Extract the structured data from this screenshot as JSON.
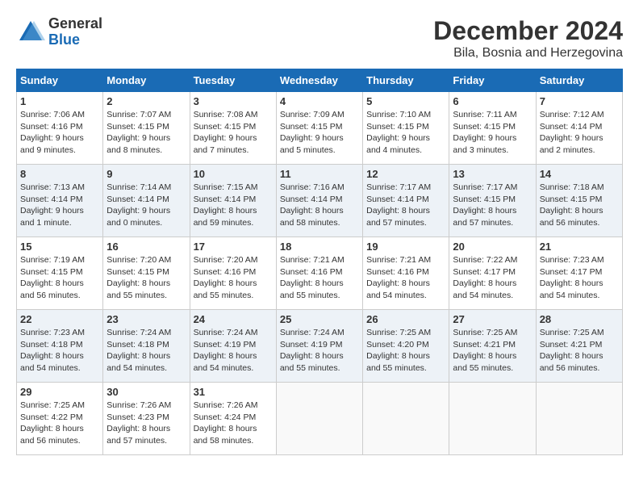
{
  "logo": {
    "general": "General",
    "blue": "Blue"
  },
  "title": "December 2024",
  "subtitle": "Bila, Bosnia and Herzegovina",
  "days_of_week": [
    "Sunday",
    "Monday",
    "Tuesday",
    "Wednesday",
    "Thursday",
    "Friday",
    "Saturday"
  ],
  "weeks": [
    [
      {
        "day": "1",
        "info": "Sunrise: 7:06 AM\nSunset: 4:16 PM\nDaylight: 9 hours and 9 minutes."
      },
      {
        "day": "2",
        "info": "Sunrise: 7:07 AM\nSunset: 4:15 PM\nDaylight: 9 hours and 8 minutes."
      },
      {
        "day": "3",
        "info": "Sunrise: 7:08 AM\nSunset: 4:15 PM\nDaylight: 9 hours and 7 minutes."
      },
      {
        "day": "4",
        "info": "Sunrise: 7:09 AM\nSunset: 4:15 PM\nDaylight: 9 hours and 5 minutes."
      },
      {
        "day": "5",
        "info": "Sunrise: 7:10 AM\nSunset: 4:15 PM\nDaylight: 9 hours and 4 minutes."
      },
      {
        "day": "6",
        "info": "Sunrise: 7:11 AM\nSunset: 4:15 PM\nDaylight: 9 hours and 3 minutes."
      },
      {
        "day": "7",
        "info": "Sunrise: 7:12 AM\nSunset: 4:14 PM\nDaylight: 9 hours and 2 minutes."
      }
    ],
    [
      {
        "day": "8",
        "info": "Sunrise: 7:13 AM\nSunset: 4:14 PM\nDaylight: 9 hours and 1 minute."
      },
      {
        "day": "9",
        "info": "Sunrise: 7:14 AM\nSunset: 4:14 PM\nDaylight: 9 hours and 0 minutes."
      },
      {
        "day": "10",
        "info": "Sunrise: 7:15 AM\nSunset: 4:14 PM\nDaylight: 8 hours and 59 minutes."
      },
      {
        "day": "11",
        "info": "Sunrise: 7:16 AM\nSunset: 4:14 PM\nDaylight: 8 hours and 58 minutes."
      },
      {
        "day": "12",
        "info": "Sunrise: 7:17 AM\nSunset: 4:14 PM\nDaylight: 8 hours and 57 minutes."
      },
      {
        "day": "13",
        "info": "Sunrise: 7:17 AM\nSunset: 4:15 PM\nDaylight: 8 hours and 57 minutes."
      },
      {
        "day": "14",
        "info": "Sunrise: 7:18 AM\nSunset: 4:15 PM\nDaylight: 8 hours and 56 minutes."
      }
    ],
    [
      {
        "day": "15",
        "info": "Sunrise: 7:19 AM\nSunset: 4:15 PM\nDaylight: 8 hours and 56 minutes."
      },
      {
        "day": "16",
        "info": "Sunrise: 7:20 AM\nSunset: 4:15 PM\nDaylight: 8 hours and 55 minutes."
      },
      {
        "day": "17",
        "info": "Sunrise: 7:20 AM\nSunset: 4:16 PM\nDaylight: 8 hours and 55 minutes."
      },
      {
        "day": "18",
        "info": "Sunrise: 7:21 AM\nSunset: 4:16 PM\nDaylight: 8 hours and 55 minutes."
      },
      {
        "day": "19",
        "info": "Sunrise: 7:21 AM\nSunset: 4:16 PM\nDaylight: 8 hours and 54 minutes."
      },
      {
        "day": "20",
        "info": "Sunrise: 7:22 AM\nSunset: 4:17 PM\nDaylight: 8 hours and 54 minutes."
      },
      {
        "day": "21",
        "info": "Sunrise: 7:23 AM\nSunset: 4:17 PM\nDaylight: 8 hours and 54 minutes."
      }
    ],
    [
      {
        "day": "22",
        "info": "Sunrise: 7:23 AM\nSunset: 4:18 PM\nDaylight: 8 hours and 54 minutes."
      },
      {
        "day": "23",
        "info": "Sunrise: 7:24 AM\nSunset: 4:18 PM\nDaylight: 8 hours and 54 minutes."
      },
      {
        "day": "24",
        "info": "Sunrise: 7:24 AM\nSunset: 4:19 PM\nDaylight: 8 hours and 54 minutes."
      },
      {
        "day": "25",
        "info": "Sunrise: 7:24 AM\nSunset: 4:19 PM\nDaylight: 8 hours and 55 minutes."
      },
      {
        "day": "26",
        "info": "Sunrise: 7:25 AM\nSunset: 4:20 PM\nDaylight: 8 hours and 55 minutes."
      },
      {
        "day": "27",
        "info": "Sunrise: 7:25 AM\nSunset: 4:21 PM\nDaylight: 8 hours and 55 minutes."
      },
      {
        "day": "28",
        "info": "Sunrise: 7:25 AM\nSunset: 4:21 PM\nDaylight: 8 hours and 56 minutes."
      }
    ],
    [
      {
        "day": "29",
        "info": "Sunrise: 7:25 AM\nSunset: 4:22 PM\nDaylight: 8 hours and 56 minutes."
      },
      {
        "day": "30",
        "info": "Sunrise: 7:26 AM\nSunset: 4:23 PM\nDaylight: 8 hours and 57 minutes."
      },
      {
        "day": "31",
        "info": "Sunrise: 7:26 AM\nSunset: 4:24 PM\nDaylight: 8 hours and 58 minutes."
      },
      null,
      null,
      null,
      null
    ]
  ]
}
